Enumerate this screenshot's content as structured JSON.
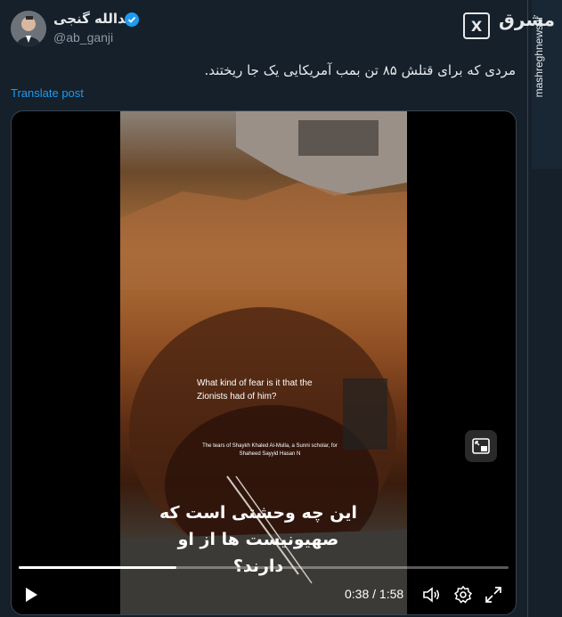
{
  "tweet": {
    "author_name": "عبدالله گنجی",
    "handle": "@ab_ganji",
    "text": "مردی که برای قتلش ۸۵ تن بمب آمریکایی یک جا ریختند.",
    "translate_label": "Translate post"
  },
  "video": {
    "caption_en": "What kind of fear is it that the Zionists had of him?",
    "caption_small": "The tears of Shaykh Khaled Al-Mulla, a Sunni scholar, for Shaheed Sayyid Hasan N",
    "caption_fa": "این چه وحشتی است که صهیونیست ها از او دارند؟",
    "current_time": "0:38",
    "separator": "/",
    "duration": "1:58",
    "progress_fraction": 0.322
  },
  "watermark": {
    "site": "mashreghnews.ir",
    "logo_text": "مشرق"
  },
  "icons": {
    "verified": "verified-badge-icon",
    "x_logo": "x-logo-icon",
    "play": "play-icon",
    "volume": "volume-icon",
    "settings": "gear-icon",
    "fullscreen": "fullscreen-icon",
    "pip": "picture-in-picture-icon"
  },
  "colors": {
    "background": "#15202b",
    "link": "#1d9bf0",
    "verified": "#1d9bf0"
  }
}
